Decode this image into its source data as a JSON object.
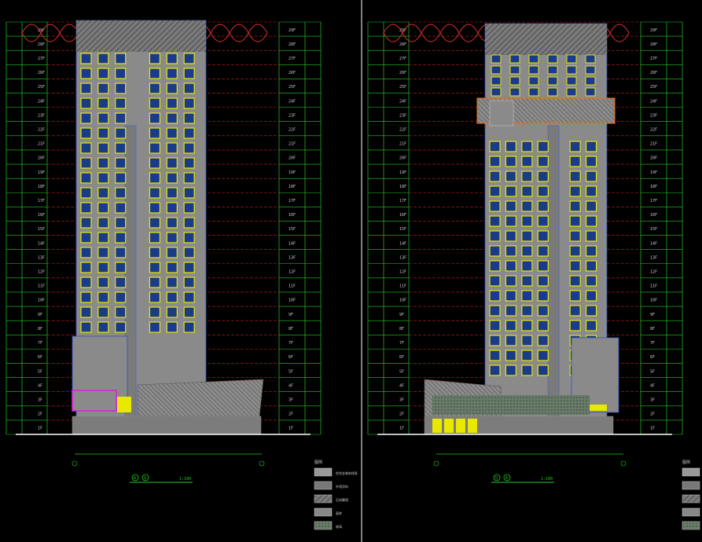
{
  "colors": {
    "background": "#000000",
    "grid_red": "#c81e1e",
    "grid_green": "#22cc22",
    "facade": "#8a8a8a",
    "window": "#e8e800",
    "window_glass": "#1a3a8a",
    "magenta": "#e020e0",
    "cloud": "#e03030",
    "divider": "#ffffff"
  },
  "left_sheet": {
    "title_marker_a": "A",
    "title_marker_b": "Q",
    "scale_text": "1:100",
    "floor_labels": [
      "29F",
      "28F",
      "27F",
      "26F",
      "25F",
      "24F",
      "23F",
      "22F",
      "21F",
      "20F",
      "19F",
      "18F",
      "17F",
      "16F",
      "15F",
      "14F",
      "13F",
      "12F",
      "11F",
      "10F",
      "9F",
      "8F",
      "7F",
      "6F",
      "5F",
      "4F",
      "3F",
      "2F",
      "1F"
    ]
  },
  "right_sheet": {
    "title_marker_a": "Q",
    "title_marker_b": "A",
    "scale_text": "1:100",
    "floor_labels": [
      "29F",
      "28F",
      "27F",
      "26F",
      "25F",
      "24F",
      "23F",
      "22F",
      "21F",
      "20F",
      "19F",
      "18F",
      "17F",
      "16F",
      "15F",
      "14F",
      "13F",
      "12F",
      "11F",
      "10F",
      "9F",
      "8F",
      "7F",
      "6F",
      "5F",
      "4F",
      "3F",
      "2F",
      "1F"
    ]
  },
  "legend": {
    "title": "图例",
    "items": [
      "铝合金装饰线条",
      "外墙涂料",
      "石材幕墙",
      "面砖",
      "玻璃"
    ]
  }
}
